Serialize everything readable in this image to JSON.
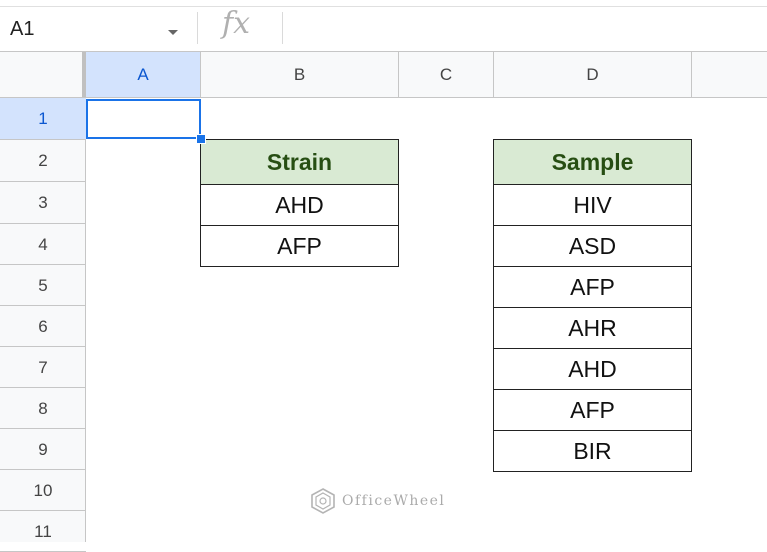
{
  "formula_bar": {
    "cell_ref": "A1",
    "fx_label": "fx",
    "formula": ""
  },
  "columns": [
    "A",
    "B",
    "C",
    "D"
  ],
  "rows": [
    "1",
    "2",
    "3",
    "4",
    "5",
    "6",
    "7",
    "8",
    "9",
    "10",
    "11"
  ],
  "selected_cell": "A1",
  "strain_table": {
    "header": "Strain",
    "values": [
      "AHD",
      "AFP"
    ]
  },
  "sample_table": {
    "header": "Sample",
    "values": [
      "HIV",
      "ASD",
      "AFP",
      "AHR",
      "AHD",
      "AFP",
      "BIR"
    ]
  },
  "watermark": {
    "text": "OfficeWheel"
  },
  "colors": {
    "selection": "#1a73e8",
    "header_fill": "#d9ead3",
    "header_text": "#274e13"
  }
}
